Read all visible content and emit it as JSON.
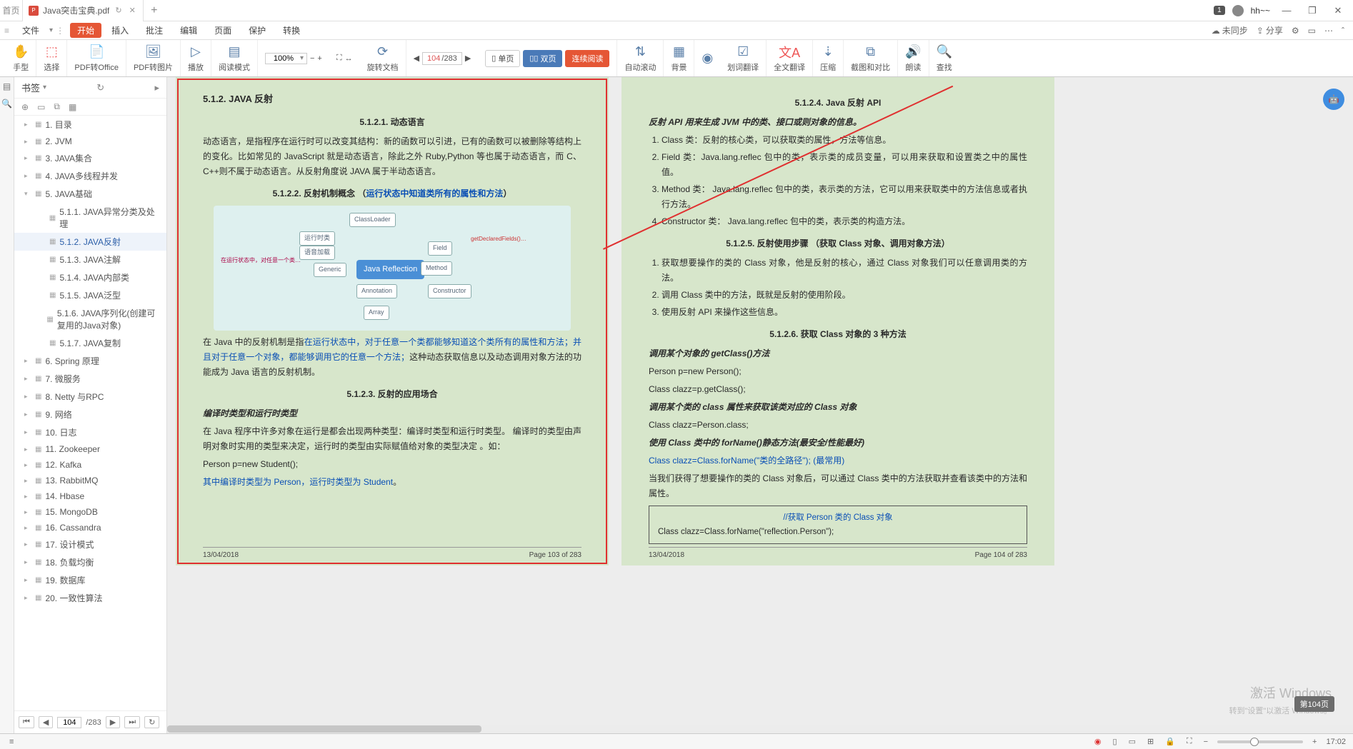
{
  "tab": {
    "home": "首页",
    "title": "Java突击宝典.pdf",
    "add": "+"
  },
  "title_right": {
    "badge": "1",
    "user": "hh~~"
  },
  "menu": {
    "grip": "≡",
    "file": "文件",
    "items": [
      "开始",
      "插入",
      "批注",
      "编辑",
      "页面",
      "保护",
      "转换"
    ],
    "sync": "未同步",
    "share": "分享"
  },
  "tool": {
    "hand": "手型",
    "select": "选择",
    "pdf_office": "PDF转Office",
    "pdf_img": "PDF转图片",
    "play": "播放",
    "reading": "阅读模式",
    "zoom": "100%",
    "zoomin": "+",
    "zoomout": "−",
    "fitpage": "⛶",
    "fitrow": "↔",
    "cur_page": "104",
    "total_page": "/283",
    "prev": "◀",
    "next": "▶",
    "rotate": "旋转文档",
    "single": "单页",
    "double": "双页",
    "continuous": "连续阅读",
    "autoscroll": "自动滚动",
    "bg": "背景",
    "eye": "◉",
    "trans_word": "划词翻译",
    "trans_full": "全文翻译",
    "compress": "压缩",
    "compare": "截图和对比",
    "read_aloud": "朗读",
    "find": "查找"
  },
  "sidebar": {
    "title": "书签",
    "icons": [
      "⊕",
      "▭",
      "⧉",
      "▦"
    ],
    "items": [
      {
        "l": 1,
        "t": "1. 目录"
      },
      {
        "l": 1,
        "t": "2. JVM"
      },
      {
        "l": 1,
        "t": "3. JAVA集合"
      },
      {
        "l": 1,
        "t": "4. JAVA多线程并发"
      },
      {
        "l": 1,
        "t": "5. JAVA基础",
        "exp": true
      },
      {
        "l": 2,
        "t": "5.1.1. JAVA异常分类及处理"
      },
      {
        "l": 2,
        "t": "5.1.2. JAVA反射",
        "sel": true
      },
      {
        "l": 2,
        "t": "5.1.3. JAVA注解"
      },
      {
        "l": 2,
        "t": "5.1.4. JAVA内部类"
      },
      {
        "l": 2,
        "t": "5.1.5. JAVA泛型"
      },
      {
        "l": 2,
        "t": "5.1.6. JAVA序列化(创建可复用的Java对象)"
      },
      {
        "l": 2,
        "t": "5.1.7. JAVA复制"
      },
      {
        "l": 1,
        "t": "6. Spring 原理"
      },
      {
        "l": 1,
        "t": "7. 微服务"
      },
      {
        "l": 1,
        "t": "8. Netty 与RPC"
      },
      {
        "l": 1,
        "t": "9. 网络"
      },
      {
        "l": 1,
        "t": "10. 日志"
      },
      {
        "l": 1,
        "t": "11. Zookeeper"
      },
      {
        "l": 1,
        "t": "12. Kafka"
      },
      {
        "l": 1,
        "t": "13. RabbitMQ"
      },
      {
        "l": 1,
        "t": "14. Hbase"
      },
      {
        "l": 1,
        "t": "15. MongoDB"
      },
      {
        "l": 1,
        "t": "16. Cassandra"
      },
      {
        "l": 1,
        "t": "17. 设计模式"
      },
      {
        "l": 1,
        "t": "18. 负载均衡"
      },
      {
        "l": 1,
        "t": "19. 数据库"
      },
      {
        "l": 1,
        "t": "20. 一致性算法"
      }
    ],
    "page_in": "104",
    "page_total": "/283"
  },
  "doc": {
    "left": {
      "h3": "5.1.2.  JAVA 反射",
      "s1": "5.1.2.1.    动态语言",
      "p1": "动态语言，是指程序在运行时可以改变其结构：新的函数可以引进，已有的函数可以被删除等结构上的变化。比如常见的 JavaScript 就是动态语言，除此之外 Ruby,Python 等也属于动态语言，而 C、C++则不属于动态语言。从反射角度说 JAVA 属于半动态语言。",
      "s2a": "5.1.2.2.    反射机制概念  （",
      "s2b": "运行状态中知道类所有的属性和方法",
      "s2c": "）",
      "p2a": "在 Java 中的反射机制是指",
      "p2b": "在运行状态中，对于任意一个类都能够知道这个类所有的属性和方法；并且对于任意一个对象，都能够调用它的任意一个方法；",
      "p2c": "这种动态获取信息以及动态调用对象方法的功能成为 Java 语言的反射机制。",
      "s3": "5.1.2.3.    反射的应用场合",
      "i1": "编译时类型和运行时类型",
      "p3": "在 Java 程序中许多对象在运行是都会出现两种类型：编译时类型和运行时类型。 编译时的类型由声明对象时实用的类型来决定，运行时的类型由实际赋值给对象的类型决定 。如：",
      "c1": "Person p=new Student();",
      "p4a": "其中编译时类型为 Person，运行时类型为 Student",
      "p4b": "。",
      "date": "13/04/2018",
      "pg": "Page 103 of 283",
      "mm": {
        "center": "Java Reflection",
        "nodes": [
          "ClassLoader",
          "运行时类",
          "语音加载",
          "Generic",
          "Method",
          "Annotation",
          "Array",
          "Constructor",
          "Field"
        ]
      }
    },
    "right": {
      "h4a": "5.1.2.4.    Java 反射 API",
      "i1": "反射 API 用来生成 JVM 中的类、接口或则对象的信息。",
      "ol1": [
        "Class 类：反射的核心类，可以获取类的属性，方法等信息。",
        "Field 类：Java.lang.reflec 包中的类，表示类的成员变量，可以用来获取和设置类之中的属性值。",
        "Method 类：  Java.lang.reflec 包中的类，表示类的方法，它可以用来获取类中的方法信息或者执行方法。",
        "Constructor 类：  Java.lang.reflec 包中的类，表示类的构造方法。"
      ],
      "h4b": "5.1.2.5.    反射使用步骤  （获取 Class 对象、调用对象方法）",
      "ol2": [
        "获取想要操作的类的 Class 对象，他是反射的核心，通过 Class 对象我们可以任意调用类的方法。",
        "调用 Class 类中的方法，既就是反射的使用阶段。",
        "使用反射 API 来操作这些信息。"
      ],
      "h4c": "5.1.2.6.    获取 Class 对象的 3 种方法",
      "i2": "调用某个对象的 getClass()方法",
      "c2": "Person p=new Person();",
      "c3": "Class clazz=p.getClass();",
      "i3": "调用某个类的 class 属性来获取该类对应的 Class 对象",
      "c4": "Class clazz=Person.class;",
      "i4": "使用 Class 类中的 forName()静态方法(最安全/性能最好)",
      "c5": "Class clazz=Class.forName(\"类的全路径\"); (最常用)",
      "p5": "当我们获得了想要操作的类的 Class 对象后，可以通过 Class 类中的方法获取并查看该类中的方法和属性。",
      "box1": "//获取 Person 类的 Class 对象",
      "box2": "Class clazz=Class.forName(\"reflection.Person\");",
      "date": "13/04/2018",
      "pg": "Page 104 of 283"
    },
    "page_lbl": "第104页",
    "wm1": "激活 Windows",
    "wm2": "转到\"设置\"以激活 Windows。"
  },
  "status": {
    "time": "17:02"
  }
}
